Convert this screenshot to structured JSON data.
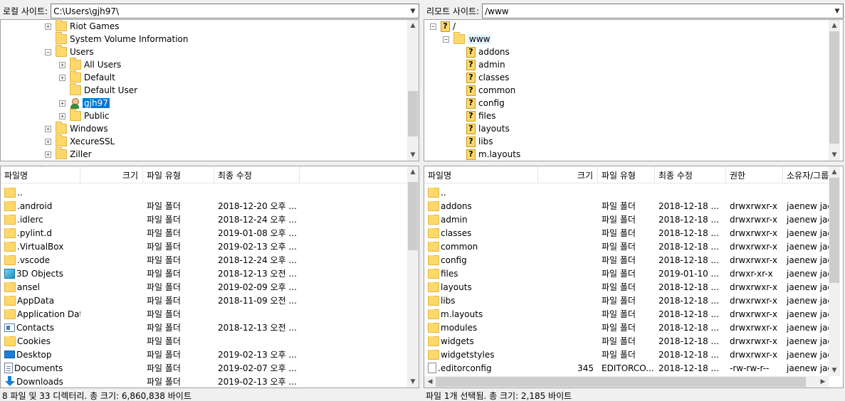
{
  "local": {
    "site_label": "로컬 사이트:",
    "path": "C:\\Users\\gjh97\\",
    "tree": [
      {
        "label": "Riot Games",
        "icon": "folder",
        "expander": "+",
        "level": 0
      },
      {
        "label": "System Volume Information",
        "icon": "folder",
        "expander": "",
        "level": 0
      },
      {
        "label": "Users",
        "icon": "folder",
        "expander": "-",
        "level": 0
      },
      {
        "label": "All Users",
        "icon": "folder",
        "expander": "+",
        "level": 1
      },
      {
        "label": "Default",
        "icon": "folder",
        "expander": "+",
        "level": 1
      },
      {
        "label": "Default User",
        "icon": "folder",
        "expander": "",
        "level": 1
      },
      {
        "label": "gjh97",
        "icon": "user",
        "expander": "+",
        "level": 1,
        "selected": true
      },
      {
        "label": "Public",
        "icon": "folder",
        "expander": "+",
        "level": 1
      },
      {
        "label": "Windows",
        "icon": "folder",
        "expander": "+",
        "level": 0
      },
      {
        "label": "XecureSSL",
        "icon": "folder",
        "expander": "+",
        "level": 0
      },
      {
        "label": "Ziller",
        "icon": "folder",
        "expander": "+",
        "level": 0
      }
    ],
    "columns": [
      "파일명",
      "크기",
      "파일 유형",
      "최종 수정"
    ],
    "files": [
      {
        "name": "..",
        "icon": "folder",
        "size": "",
        "type": "",
        "modified": ""
      },
      {
        "name": ".android",
        "icon": "folder",
        "size": "",
        "type": "파일 폴더",
        "modified": "2018-12-20 오후 ..."
      },
      {
        "name": ".idlerc",
        "icon": "folder",
        "size": "",
        "type": "파일 폴더",
        "modified": "2018-12-24 오후 ..."
      },
      {
        "name": ".pylint.d",
        "icon": "folder",
        "size": "",
        "type": "파일 폴더",
        "modified": "2019-01-08 오후 ..."
      },
      {
        "name": ".VirtualBox",
        "icon": "folder",
        "size": "",
        "type": "파일 폴더",
        "modified": "2019-02-13 오후 ..."
      },
      {
        "name": ".vscode",
        "icon": "folder",
        "size": "",
        "type": "파일 폴더",
        "modified": "2018-12-24 오후 ..."
      },
      {
        "name": "3D Objects",
        "icon": "3d",
        "size": "",
        "type": "파일 폴더",
        "modified": "2018-12-13 오전 ..."
      },
      {
        "name": "ansel",
        "icon": "folder",
        "size": "",
        "type": "파일 폴더",
        "modified": "2019-02-09 오후 ..."
      },
      {
        "name": "AppData",
        "icon": "folder",
        "size": "",
        "type": "파일 폴더",
        "modified": "2018-11-09 오전 ..."
      },
      {
        "name": "Application Data",
        "icon": "folder",
        "size": "",
        "type": "파일 폴더",
        "modified": ""
      },
      {
        "name": "Contacts",
        "icon": "contacts",
        "size": "",
        "type": "파일 폴더",
        "modified": "2018-12-13 오전 ..."
      },
      {
        "name": "Cookies",
        "icon": "folder",
        "size": "",
        "type": "파일 폴더",
        "modified": ""
      },
      {
        "name": "Desktop",
        "icon": "desktop",
        "size": "",
        "type": "파일 폴더",
        "modified": "2019-02-13 오후 ..."
      },
      {
        "name": "Documents",
        "icon": "document",
        "size": "",
        "type": "파일 폴더",
        "modified": "2019-02-07 오후 ..."
      },
      {
        "name": "Downloads",
        "icon": "download",
        "size": "",
        "type": "파일 폴더",
        "modified": "2019-02-13 오후 ..."
      }
    ],
    "status": "8 파일 및 33 디렉터리. 총 크기: 6,860,838 바이트"
  },
  "remote": {
    "site_label": "리모트 사이트:",
    "path": "/www",
    "tree": [
      {
        "label": "/",
        "icon": "unknown",
        "expander": "-",
        "level": 0
      },
      {
        "label": "www",
        "icon": "folder",
        "expander": "-",
        "level": 1,
        "hover": true
      },
      {
        "label": "addons",
        "icon": "unknown",
        "expander": "",
        "level": 2
      },
      {
        "label": "admin",
        "icon": "unknown",
        "expander": "",
        "level": 2
      },
      {
        "label": "classes",
        "icon": "unknown",
        "expander": "",
        "level": 2
      },
      {
        "label": "common",
        "icon": "unknown",
        "expander": "",
        "level": 2
      },
      {
        "label": "config",
        "icon": "unknown",
        "expander": "",
        "level": 2
      },
      {
        "label": "files",
        "icon": "unknown",
        "expander": "",
        "level": 2
      },
      {
        "label": "layouts",
        "icon": "unknown",
        "expander": "",
        "level": 2
      },
      {
        "label": "libs",
        "icon": "unknown",
        "expander": "",
        "level": 2
      },
      {
        "label": "m.layouts",
        "icon": "unknown",
        "expander": "",
        "level": 2
      }
    ],
    "columns": [
      "파일명",
      "크기",
      "파일 유형",
      "최종 수정",
      "권한",
      "소유자/그룹"
    ],
    "files": [
      {
        "name": "..",
        "icon": "folder",
        "size": "",
        "type": "",
        "modified": "",
        "perm": "",
        "owner": ""
      },
      {
        "name": "addons",
        "icon": "folder",
        "size": "",
        "type": "파일 폴더",
        "modified": "2018-12-18 ...",
        "perm": "drwxrwxr-x",
        "owner": "jaenew jae..."
      },
      {
        "name": "admin",
        "icon": "folder",
        "size": "",
        "type": "파일 폴더",
        "modified": "2018-12-18 ...",
        "perm": "drwxrwxr-x",
        "owner": "jaenew jae..."
      },
      {
        "name": "classes",
        "icon": "folder",
        "size": "",
        "type": "파일 폴더",
        "modified": "2018-12-18 ...",
        "perm": "drwxrwxr-x",
        "owner": "jaenew jae..."
      },
      {
        "name": "common",
        "icon": "folder",
        "size": "",
        "type": "파일 폴더",
        "modified": "2018-12-18 ...",
        "perm": "drwxrwxr-x",
        "owner": "jaenew jae..."
      },
      {
        "name": "config",
        "icon": "folder",
        "size": "",
        "type": "파일 폴더",
        "modified": "2018-12-18 ...",
        "perm": "drwxrwxr-x",
        "owner": "jaenew jae..."
      },
      {
        "name": "files",
        "icon": "folder",
        "size": "",
        "type": "파일 폴더",
        "modified": "2019-01-10 ...",
        "perm": "drwxr-xr-x",
        "owner": "jaenew jae..."
      },
      {
        "name": "layouts",
        "icon": "folder",
        "size": "",
        "type": "파일 폴더",
        "modified": "2018-12-18 ...",
        "perm": "drwxrwxr-x",
        "owner": "jaenew jae..."
      },
      {
        "name": "libs",
        "icon": "folder",
        "size": "",
        "type": "파일 폴더",
        "modified": "2018-12-18 ...",
        "perm": "drwxrwxr-x",
        "owner": "jaenew jae..."
      },
      {
        "name": "m.layouts",
        "icon": "folder",
        "size": "",
        "type": "파일 폴더",
        "modified": "2018-12-18 ...",
        "perm": "drwxrwxr-x",
        "owner": "jaenew jae..."
      },
      {
        "name": "modules",
        "icon": "folder",
        "size": "",
        "type": "파일 폴더",
        "modified": "2018-12-18 ...",
        "perm": "drwxrwxr-x",
        "owner": "jaenew jae..."
      },
      {
        "name": "widgets",
        "icon": "folder",
        "size": "",
        "type": "파일 폴더",
        "modified": "2018-12-18 ...",
        "perm": "drwxrwxr-x",
        "owner": "jaenew jae..."
      },
      {
        "name": "widgetstyles",
        "icon": "folder",
        "size": "",
        "type": "파일 폴더",
        "modified": "2018-12-18 ...",
        "perm": "drwxrwxr-x",
        "owner": "jaenew jae..."
      },
      {
        "name": ".editorconfig",
        "icon": "file",
        "size": "345",
        "type": "EDITORCO...",
        "modified": "2018-12-18 ...",
        "perm": "-rw-rw-r--",
        "owner": "jaenew jae..."
      }
    ],
    "status": "파일 1개 선택됨. 총 크기: 2,185 바이트"
  }
}
